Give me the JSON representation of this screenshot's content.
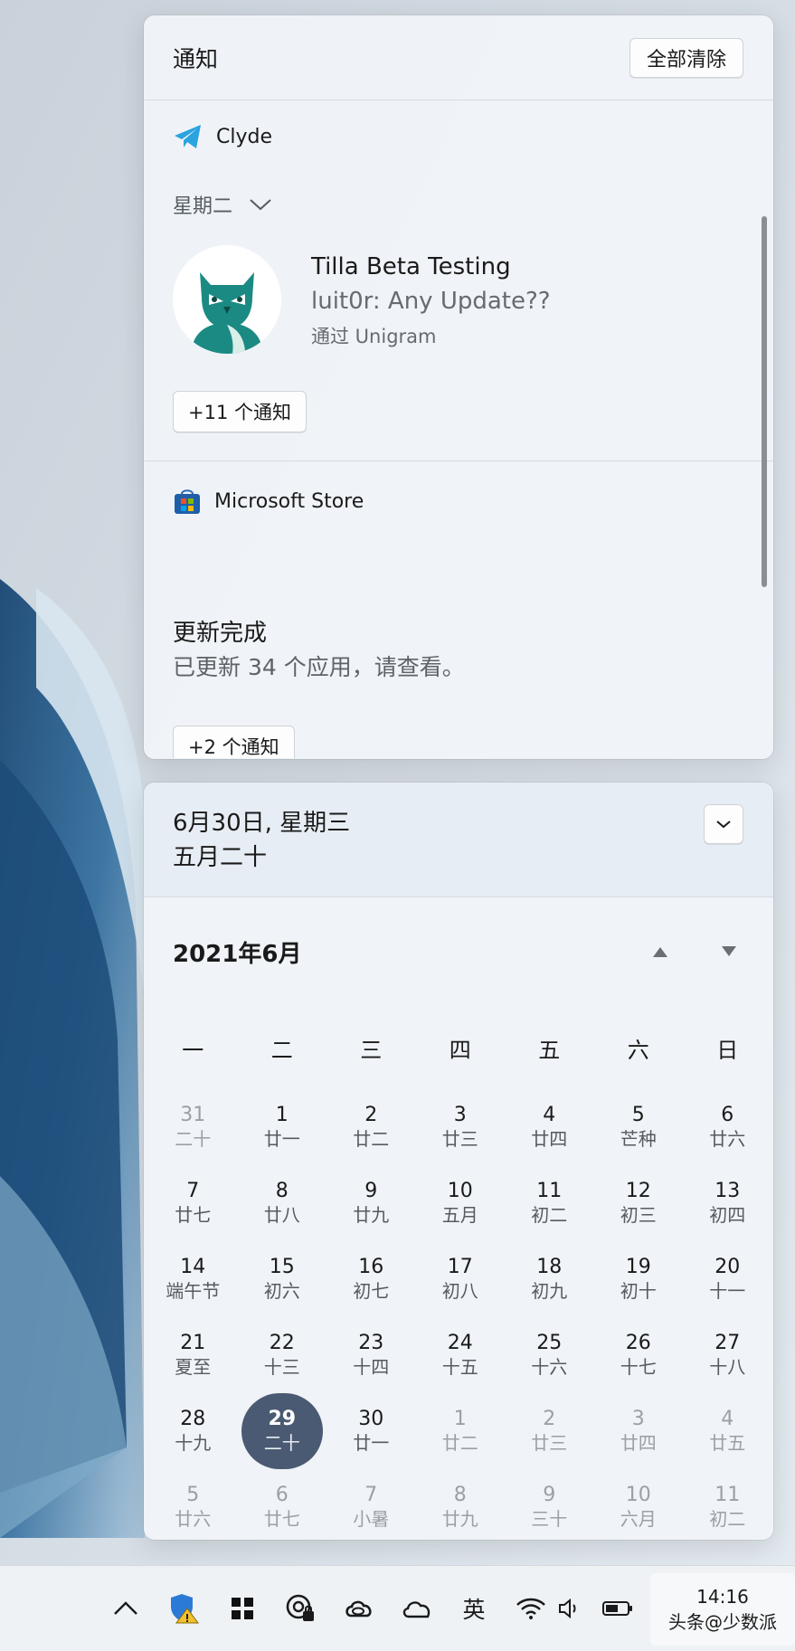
{
  "notifications": {
    "title": "通知",
    "clear_all_label": "全部清除",
    "groups": [
      {
        "app_name": "Clyde",
        "app_icon": "telegram-icon",
        "day_label": "星期二",
        "notification": {
          "title": "Tilla Beta Testing",
          "message": "luit0r: Any Update??",
          "via": "通过 Unigram",
          "avatar": "owl-avatar"
        },
        "more_label": "+11 个通知"
      },
      {
        "app_name": "Microsoft Store",
        "app_icon": "microsoft-store-icon",
        "notification": {
          "title": "更新完成",
          "message": "已更新 34 个应用，请查看。"
        },
        "more_label": "+2 个通知"
      }
    ]
  },
  "calendar": {
    "date_line": "6月30日, 星期三",
    "lunar_line": "五月二十",
    "month_label": "2021年6月",
    "weekdays": [
      "一",
      "二",
      "三",
      "四",
      "五",
      "六",
      "日"
    ],
    "weeks": [
      [
        {
          "d": "31",
          "l": "二十",
          "dim": true
        },
        {
          "d": "1",
          "l": "廿一"
        },
        {
          "d": "2",
          "l": "廿二"
        },
        {
          "d": "3",
          "l": "廿三"
        },
        {
          "d": "4",
          "l": "廿四"
        },
        {
          "d": "5",
          "l": "芒种"
        },
        {
          "d": "6",
          "l": "廿六"
        }
      ],
      [
        {
          "d": "7",
          "l": "廿七"
        },
        {
          "d": "8",
          "l": "廿八"
        },
        {
          "d": "9",
          "l": "廿九"
        },
        {
          "d": "10",
          "l": "五月"
        },
        {
          "d": "11",
          "l": "初二"
        },
        {
          "d": "12",
          "l": "初三"
        },
        {
          "d": "13",
          "l": "初四"
        }
      ],
      [
        {
          "d": "14",
          "l": "端午节"
        },
        {
          "d": "15",
          "l": "初六"
        },
        {
          "d": "16",
          "l": "初七"
        },
        {
          "d": "17",
          "l": "初八"
        },
        {
          "d": "18",
          "l": "初九"
        },
        {
          "d": "19",
          "l": "初十"
        },
        {
          "d": "20",
          "l": "十一"
        }
      ],
      [
        {
          "d": "21",
          "l": "夏至"
        },
        {
          "d": "22",
          "l": "十三"
        },
        {
          "d": "23",
          "l": "十四"
        },
        {
          "d": "24",
          "l": "十五"
        },
        {
          "d": "25",
          "l": "十六"
        },
        {
          "d": "26",
          "l": "十七"
        },
        {
          "d": "27",
          "l": "十八"
        }
      ],
      [
        {
          "d": "28",
          "l": "十九"
        },
        {
          "d": "29",
          "l": "二十",
          "today": true
        },
        {
          "d": "30",
          "l": "廿一"
        },
        {
          "d": "1",
          "l": "廿二",
          "dim": true
        },
        {
          "d": "2",
          "l": "廿三",
          "dim": true
        },
        {
          "d": "3",
          "l": "廿四",
          "dim": true
        },
        {
          "d": "4",
          "l": "廿五",
          "dim": true
        }
      ],
      [
        {
          "d": "5",
          "l": "廿六",
          "dim": true
        },
        {
          "d": "6",
          "l": "廿七",
          "dim": true
        },
        {
          "d": "7",
          "l": "小暑",
          "dim": true
        },
        {
          "d": "8",
          "l": "廿九",
          "dim": true
        },
        {
          "d": "9",
          "l": "三十",
          "dim": true
        },
        {
          "d": "10",
          "l": "六月",
          "dim": true
        },
        {
          "d": "11",
          "l": "初二",
          "dim": true
        }
      ]
    ]
  },
  "taskbar": {
    "tray_icons": [
      "chevron-up-icon",
      "windows-security-warning-icon",
      "app-tile-icon",
      "vpn-lock-icon",
      "creative-cloud-icon",
      "onedrive-icon"
    ],
    "ime_label": "英",
    "status_icons": [
      "wifi-icon",
      "volume-icon",
      "battery-icon"
    ],
    "clock_time": "14:16",
    "clock_date": "头条@少数派"
  },
  "colors": {
    "accent_today": "#4a5a72",
    "telegram_blue": "#2aa3e0",
    "owl_teal": "#1b8a83"
  }
}
